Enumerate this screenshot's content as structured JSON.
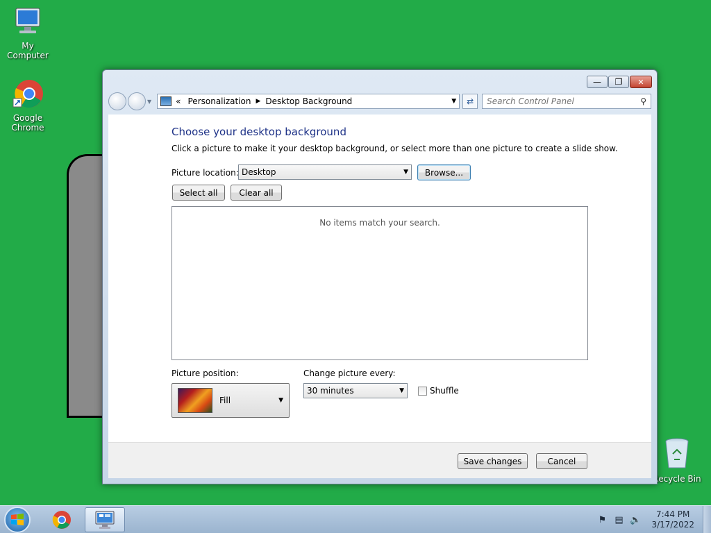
{
  "desktop": {
    "icons": [
      {
        "label": "My Computer",
        "icon": "computer-icon"
      },
      {
        "label": "Google Chrome",
        "icon": "chrome-icon"
      },
      {
        "label": "Recycle Bin",
        "icon": "recycle-bin-icon"
      }
    ],
    "background_color": "#22ab48"
  },
  "window": {
    "breadcrumb": {
      "prefix": "«",
      "items": [
        "Personalization",
        "Desktop Background"
      ]
    },
    "search": {
      "placeholder": "Search Control Panel"
    },
    "heading": "Choose your desktop background",
    "description": "Click a picture to make it your desktop background, or select more than one picture to create a slide show.",
    "picture_location": {
      "label": "Picture location:",
      "value": "Desktop"
    },
    "browse_label": "Browse...",
    "select_all_label": "Select all",
    "clear_all_label": "Clear all",
    "empty_message": "No items match your search.",
    "picture_position": {
      "label": "Picture position:",
      "value": "Fill"
    },
    "change_picture": {
      "label": "Change picture every:",
      "value": "30 minutes"
    },
    "shuffle": {
      "label": "Shuffle",
      "checked": false
    },
    "save_label": "Save changes",
    "cancel_label": "Cancel",
    "heading_color": "#1e3287"
  },
  "taskbar": {
    "time": "7:44 PM",
    "date": "3/17/2022",
    "pinned": [
      "chrome-icon",
      "control-panel-icon"
    ]
  }
}
